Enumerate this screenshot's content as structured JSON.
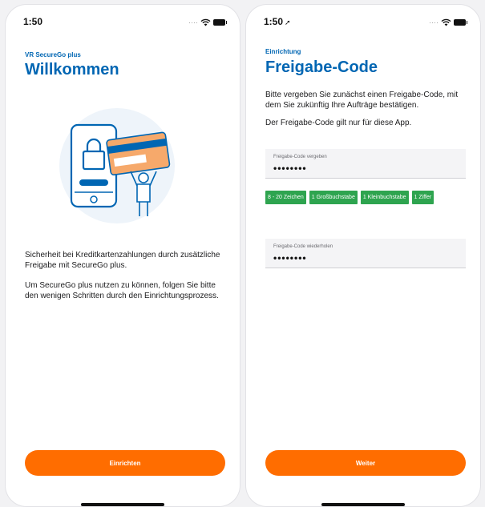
{
  "screen1": {
    "status": {
      "time": "1:50"
    },
    "eyebrow": "VR SecureGo plus",
    "title": "Willkommen",
    "paragraphs": [
      "Sicherheit bei Kreditkartenzahlungen durch zusätzliche Freigabe mit SecureGo plus.",
      "Um SecureGo plus nutzen zu können, folgen Sie bitte den wenigen Schritten durch den Einrichtungsprozess."
    ],
    "button_label": "Einrichten"
  },
  "screen2": {
    "status": {
      "time": "1:50"
    },
    "eyebrow": "Einrichtung",
    "title": "Freigabe-Code",
    "paragraphs": [
      "Bitte vergeben Sie zunächst einen Freigabe-Code, mit dem Sie zukünftig Ihre Aufträge bestätigen.",
      "Der Freigabe-Code gilt nur für diese App."
    ],
    "field1": {
      "label": "Freigabe-Code vergeben",
      "value": "••••••••"
    },
    "chips": [
      "8 - 20 Zeichen",
      "1 Großbuchstabe",
      "1 Kleinbuchstabe",
      "1 Ziffer"
    ],
    "field2": {
      "label": "Freigabe-Code wiederholen",
      "value": "••••••••"
    },
    "button_label": "Weiter"
  },
  "colors": {
    "brand_blue": "#0066b3",
    "cta_orange": "#ff6d00",
    "chip_green": "#2ea44f"
  },
  "icons": [
    "wifi-icon",
    "battery-icon",
    "location-arrow-icon",
    "security-illustration"
  ]
}
